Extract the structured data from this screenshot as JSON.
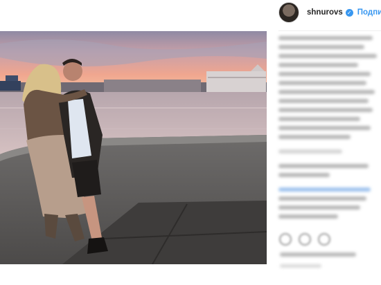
{
  "post": {
    "username": "shnurovs",
    "follow_label": "Подписат",
    "verified_mark": "✓"
  },
  "icons": {
    "avatar": "profile-avatar",
    "verified": "verified-badge-icon",
    "like": "heart-icon",
    "comment": "comment-icon",
    "share": "share-icon"
  },
  "colors": {
    "link_blue": "#3897f0",
    "text": "#262626",
    "sky_pink": "#e9a7a0",
    "water": "#c7b5b6"
  }
}
